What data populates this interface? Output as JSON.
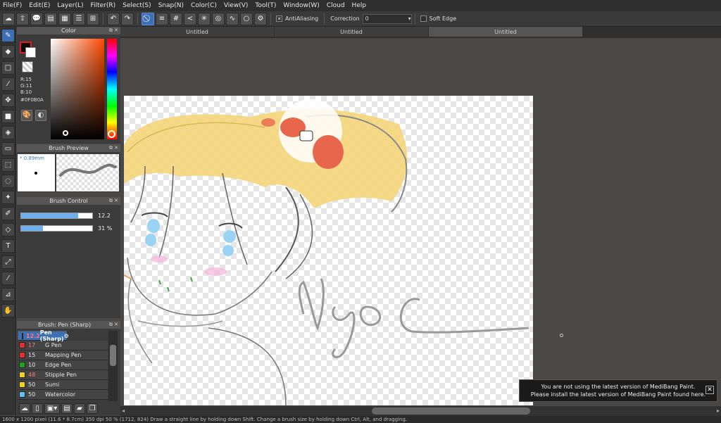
{
  "menu": [
    "File(F)",
    "Edit(E)",
    "Layer(L)",
    "Filter(R)",
    "Select(S)",
    "Snap(N)",
    "Color(C)",
    "View(V)",
    "Tool(T)",
    "Window(W)",
    "Cloud",
    "Help"
  ],
  "toolbar": {
    "antialiasing_label": "AntiAliasing",
    "correction_label": "Correction",
    "correction_value": "0",
    "soft_edge_label": "Soft Edge"
  },
  "tabs": [
    "Untitled",
    "Untitled",
    "Untitled"
  ],
  "color_panel": {
    "title": "Color",
    "r": "R:15",
    "g": "G:11",
    "b": "B:10",
    "hex": "#0F0B0A",
    "fg_color": "#0F0B0A"
  },
  "brush_preview": {
    "title": "Brush Preview",
    "size": "0.89mm"
  },
  "brush_control": {
    "title": "Brush Control",
    "size_value": "12.2",
    "size_fraction": 0.8,
    "opacity_value": "31 %",
    "opacity_fraction": 0.31
  },
  "brush_list": {
    "title": "Brush: Pen (Sharp)",
    "items": [
      {
        "size": "12.2",
        "name": "Pen (Sharp)",
        "color": "#2a2a5a",
        "selected": true
      },
      {
        "size": "17",
        "name": "G Pen",
        "color": "#e03030"
      },
      {
        "size": "15",
        "name": "Mapping Pen",
        "color": "#e03030"
      },
      {
        "size": "10",
        "name": "Edge Pen",
        "color": "#20a020"
      },
      {
        "size": "48",
        "name": "Stipple Pen",
        "color": "#f0d020"
      },
      {
        "size": "50",
        "name": "Sumi",
        "color": "#f0d020"
      },
      {
        "size": "50",
        "name": "Watercolor",
        "color": "#60c0f0"
      }
    ]
  },
  "notice": {
    "line1": "You are not using the latest version of MediBang Paint.",
    "line2": "Please install the latest version of MediBang Paint found here."
  },
  "status": "1600 x 1200 pixel   (11.6 * 8.7cm)   350 dpi   50 %   (1712, 824)   Draw a straight line by holding down Shift. Change a brush size by holding down Ctrl, Alt, and dragging."
}
